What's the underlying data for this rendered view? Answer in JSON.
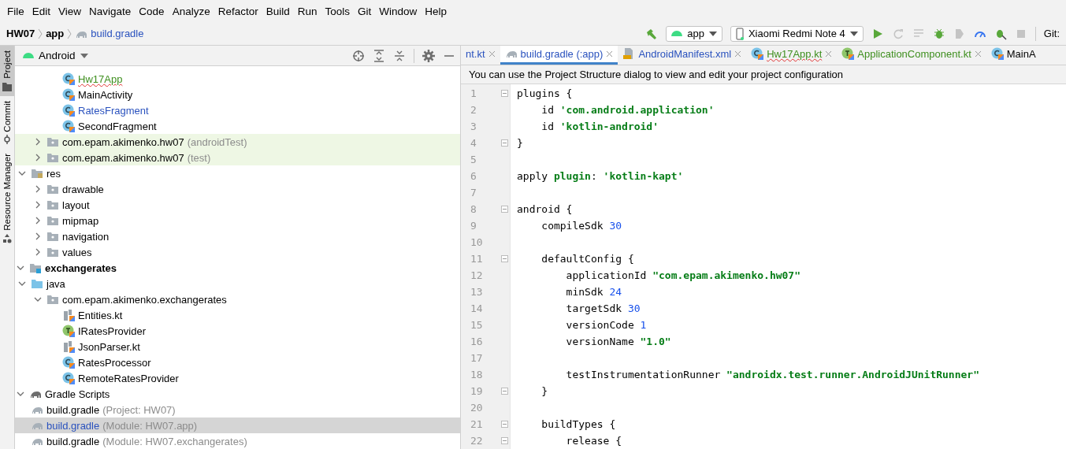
{
  "menu": [
    "File",
    "Edit",
    "View",
    "Navigate",
    "Code",
    "Analyze",
    "Refactor",
    "Build",
    "Run",
    "Tools",
    "Git",
    "Window",
    "Help"
  ],
  "breadcrumbs": [
    {
      "label": "HW07",
      "kind": "project"
    },
    {
      "label": "app",
      "kind": "module"
    },
    {
      "label": "build.gradle",
      "kind": "gradle"
    }
  ],
  "toolbar": {
    "configuration": "app",
    "device": "Xiaomi Redmi Note 4",
    "vcs_label": "Git:"
  },
  "side_tabs": [
    {
      "label": "Project",
      "selected": true
    },
    {
      "label": "Commit",
      "selected": false
    },
    {
      "label": "Resource Manager",
      "selected": false
    }
  ],
  "project_panel": {
    "view": "Android",
    "tree": [
      {
        "children": [
          {
            "children": [
              {
                "children": [
                  {
                    "label": "Hw17App",
                    "kind": "class",
                    "color": "#3f8f1f",
                    "error": true,
                    "selected": false
                  },
                  {
                    "label": "MainActivity",
                    "kind": "class",
                    "selected": false
                  },
                  {
                    "label": "RatesFragment",
                    "kind": "class",
                    "color": "#2a52be",
                    "selected": false
                  },
                  {
                    "label": "SecondFragment",
                    "kind": "class",
                    "selected": false
                  }
                ]
              },
              {
                "label": "com.epam.akimenko.hw07",
                "note": "(androidTest)",
                "kind": "test-package",
                "expanded": false,
                "selected": false
              },
              {
                "label": "com.epam.akimenko.hw07",
                "note": "(test)",
                "kind": "test-package",
                "expanded": false,
                "selected": false
              }
            ]
          },
          {
            "label": "res",
            "kind": "res-folder",
            "expanded": true,
            "selected": false,
            "children": [
              {
                "label": "drawable",
                "kind": "package",
                "expanded": false,
                "selected": false
              },
              {
                "label": "layout",
                "kind": "package",
                "expanded": false,
                "selected": false
              },
              {
                "label": "mipmap",
                "kind": "package",
                "expanded": false,
                "selected": false
              },
              {
                "label": "navigation",
                "kind": "package",
                "expanded": false,
                "selected": false
              },
              {
                "label": "values",
                "kind": "package",
                "expanded": false,
                "selected": false
              }
            ]
          }
        ]
      },
      {
        "label": "exchangerates",
        "kind": "module",
        "expanded": true,
        "selected": false,
        "children": [
          {
            "label": "java",
            "kind": "source-folder",
            "expanded": true,
            "selected": false,
            "children": [
              {
                "label": "com.epam.akimenko.exchangerates",
                "kind": "package",
                "expanded": true,
                "selected": false,
                "children": [
                  {
                    "label": "Entities.kt",
                    "kind": "kotlin-file",
                    "selected": false
                  },
                  {
                    "label": "IRatesProvider",
                    "kind": "interface",
                    "selected": false
                  },
                  {
                    "label": "JsonParser.kt",
                    "kind": "kotlin-file",
                    "selected": false
                  },
                  {
                    "label": "RatesProcessor",
                    "kind": "class",
                    "selected": false
                  },
                  {
                    "label": "RemoteRatesProvider",
                    "kind": "class",
                    "selected": false
                  }
                ]
              }
            ]
          }
        ]
      },
      {
        "label": "Gradle Scripts",
        "kind": "gradle-group",
        "expanded": true,
        "selected": false,
        "children": [
          {
            "label": "build.gradle",
            "note": "(Project: HW07)",
            "kind": "gradle",
            "selected": false
          },
          {
            "label": "build.gradle",
            "note": "(Module: HW07.app)",
            "kind": "gradle",
            "color": "#2a52be",
            "selected": true
          },
          {
            "label": "build.gradle",
            "note": "(Module: HW07.exchangerates)",
            "kind": "gradle",
            "selected": false
          }
        ]
      }
    ]
  },
  "editor": {
    "tabs": [
      {
        "label": "nt.kt",
        "kind": "none",
        "color": "#2a52be",
        "selected": false
      },
      {
        "label": "build.gradle (:app)",
        "kind": "gradle",
        "color": "#2a52be",
        "selected": true
      },
      {
        "label": "AndroidManifest.xml",
        "kind": "manifest",
        "color": "#2a52be",
        "selected": false
      },
      {
        "label": "Hw17App.kt",
        "kind": "class",
        "color": "#3f8f1f",
        "error": true,
        "selected": false
      },
      {
        "label": "ApplicationComponent.kt",
        "kind": "interface",
        "color": "#3f8f1f",
        "selected": false
      },
      {
        "label": "MainA",
        "kind": "class",
        "selected": false
      }
    ],
    "banner": "You can use the Project Structure dialog to view and edit your project configuration",
    "lines": [
      {
        "number": "1",
        "fold": true,
        "tokens": [
          {
            "text": "plugins {",
            "kind": "plain"
          }
        ]
      },
      {
        "number": "2",
        "tokens": [
          {
            "text": "    id ",
            "kind": "plain"
          },
          {
            "text": "'com.android.application'",
            "kind": "string"
          }
        ]
      },
      {
        "number": "3",
        "tokens": [
          {
            "text": "    id ",
            "kind": "plain"
          },
          {
            "text": "'kotlin-android'",
            "kind": "string"
          }
        ]
      },
      {
        "number": "4",
        "fold": true,
        "tokens": [
          {
            "text": "}",
            "kind": "plain"
          }
        ]
      },
      {
        "number": "5"
      },
      {
        "number": "6",
        "tokens": [
          {
            "text": "apply ",
            "kind": "plain"
          },
          {
            "text": "plugin",
            "kind": "keyword"
          },
          {
            "text": ": ",
            "kind": "plain"
          },
          {
            "text": "'kotlin-kapt'",
            "kind": "string"
          }
        ]
      },
      {
        "number": "7"
      },
      {
        "number": "8",
        "fold": true,
        "tokens": [
          {
            "text": "android {",
            "kind": "plain"
          }
        ]
      },
      {
        "number": "9",
        "tokens": [
          {
            "text": "    compileSdk ",
            "kind": "plain"
          },
          {
            "text": "30",
            "kind": "number"
          }
        ]
      },
      {
        "number": "10"
      },
      {
        "number": "11",
        "fold": true,
        "tokens": [
          {
            "text": "    defaultConfig {",
            "kind": "plain"
          }
        ]
      },
      {
        "number": "12",
        "tokens": [
          {
            "text": "        applicationId ",
            "kind": "plain"
          },
          {
            "text": "\"com.epam.akimenko.hw07\"",
            "kind": "string"
          }
        ]
      },
      {
        "number": "13",
        "tokens": [
          {
            "text": "        minSdk ",
            "kind": "plain"
          },
          {
            "text": "24",
            "kind": "number"
          }
        ]
      },
      {
        "number": "14",
        "tokens": [
          {
            "text": "        targetSdk ",
            "kind": "plain"
          },
          {
            "text": "30",
            "kind": "number"
          }
        ]
      },
      {
        "number": "15",
        "tokens": [
          {
            "text": "        versionCode ",
            "kind": "plain"
          },
          {
            "text": "1",
            "kind": "number"
          }
        ]
      },
      {
        "number": "16",
        "tokens": [
          {
            "text": "        versionName ",
            "kind": "plain"
          },
          {
            "text": "\"1.0\"",
            "kind": "string"
          }
        ]
      },
      {
        "number": "17"
      },
      {
        "number": "18",
        "tokens": [
          {
            "text": "        testInstrumentationRunner ",
            "kind": "plain"
          },
          {
            "text": "\"androidx.test.runner.AndroidJUnitRunner\"",
            "kind": "string"
          }
        ]
      },
      {
        "number": "19",
        "fold": true,
        "tokens": [
          {
            "text": "    }",
            "kind": "plain"
          }
        ]
      },
      {
        "number": "20"
      },
      {
        "number": "21",
        "fold": true,
        "tokens": [
          {
            "text": "    buildTypes {",
            "kind": "plain"
          }
        ]
      },
      {
        "number": "22",
        "fold": true,
        "tokens": [
          {
            "text": "        release {",
            "kind": "plain"
          }
        ]
      }
    ]
  }
}
